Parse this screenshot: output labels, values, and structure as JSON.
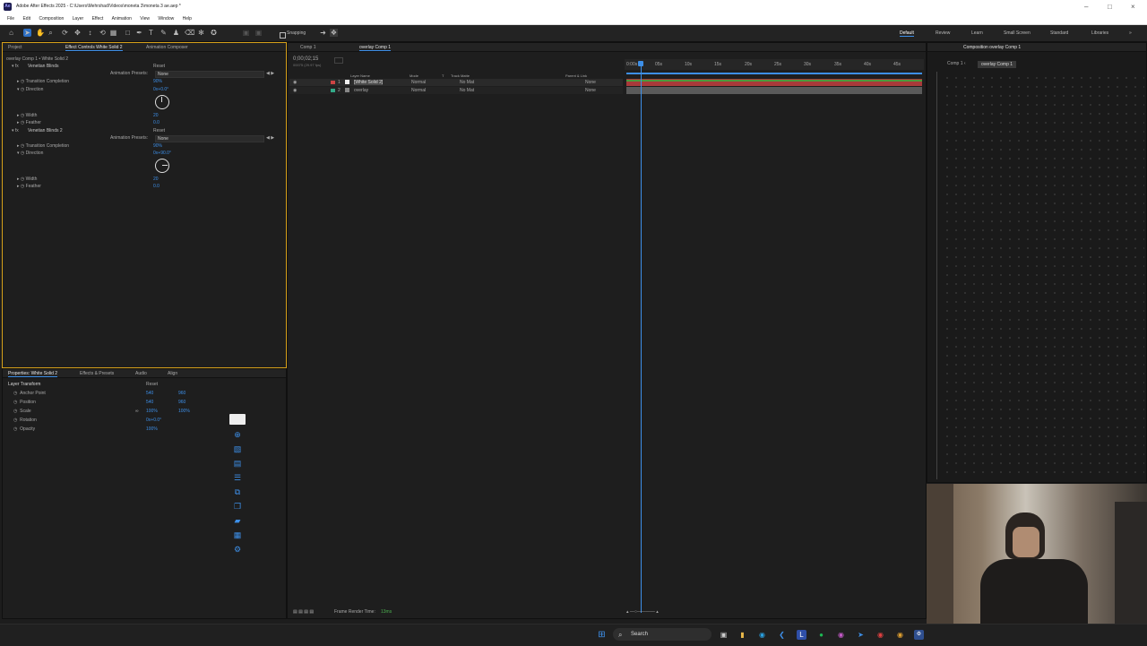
{
  "window": {
    "title": "Adobe After Effects 2025 - C:\\Users\\Mehrshad\\Videos\\moneta 3\\moneta 3 ae.aep *",
    "app_icon": "Ae"
  },
  "menu": [
    "File",
    "Edit",
    "Composition",
    "Layer",
    "Effect",
    "Animation",
    "View",
    "Window",
    "Help"
  ],
  "toolbar": {
    "snapping_label": "Snapping"
  },
  "workspaces": [
    "Default",
    "Review",
    "Learn",
    "Small Screen",
    "Standard",
    "Libraries"
  ],
  "effect_controls": {
    "tabs": [
      "Project",
      "Effect Controls White Solid 2",
      "Animation Composer"
    ],
    "layer_path": "overlay Comp 1 • White Solid 2",
    "effects": [
      {
        "name": "Venetian Blinds",
        "reset": "Reset",
        "presets_label": "Animation Presets:",
        "presets_value": "None",
        "props": [
          {
            "label": "Transition Completion",
            "value": "90%"
          },
          {
            "label": "Direction",
            "value": "0x+0.0°"
          },
          {
            "label": "Width",
            "value": "20"
          },
          {
            "label": "Feather",
            "value": "0.0"
          }
        ]
      },
      {
        "name": "Venetian Blinds 2",
        "reset": "Reset",
        "presets_label": "Animation Presets:",
        "presets_value": "None",
        "props": [
          {
            "label": "Transition Completion",
            "value": "90%"
          },
          {
            "label": "Direction",
            "value": "0x+90.0°"
          },
          {
            "label": "Width",
            "value": "20"
          },
          {
            "label": "Feather",
            "value": "0.0"
          }
        ]
      }
    ]
  },
  "properties": {
    "tabs": [
      "Properties: White Solid 2",
      "Effects & Presets",
      "Audio",
      "Align"
    ],
    "section": "Layer Transform",
    "reset": "Reset",
    "rows": [
      {
        "label": "Anchor Point",
        "v1": "540",
        "v2": "960"
      },
      {
        "label": "Position",
        "v1": "540",
        "v2": "960"
      },
      {
        "label": "Scale",
        "v1": "100%",
        "v2": "100%"
      },
      {
        "label": "Rotation",
        "v1": "0x+0.0°",
        "v2": ""
      },
      {
        "label": "Opacity",
        "v1": "100%",
        "v2": ""
      }
    ]
  },
  "timeline": {
    "tabs": [
      "Comp 1",
      "overlay Comp 1"
    ],
    "timecode": "0;00;02;15",
    "timecode_sub": "00075 (29.97 fps)",
    "columns": [
      "Layer Name",
      "Mode",
      "T",
      "Track Matte",
      "Parent & Link"
    ],
    "layers": [
      {
        "num": "1",
        "name": "[White Solid 2]",
        "mode": "Normal",
        "matte": "No Mat",
        "parent": "None"
      },
      {
        "num": "2",
        "name": "overlay",
        "mode": "Normal",
        "matte": "No Mat",
        "parent": "None"
      }
    ],
    "ruler": [
      "0:00s",
      "05s",
      "10s",
      "15s",
      "20s",
      "25s",
      "30s",
      "35s",
      "40s",
      "45s"
    ],
    "footer_label": "Frame Render Time:",
    "footer_value": "13ms"
  },
  "composition": {
    "tab": "Composition overlay Comp 1",
    "subtab": "overlay Comp 1"
  },
  "taskbar": {
    "search_placeholder": "Search"
  },
  "colors": {
    "accent": "#3d8fe8",
    "layer_green": "#4c9a3c",
    "layer_red": "#a83a3a"
  }
}
